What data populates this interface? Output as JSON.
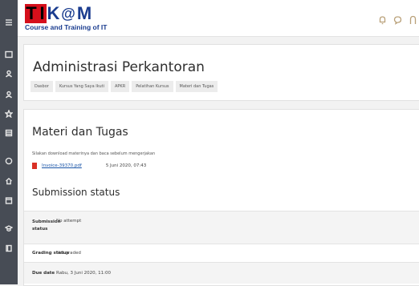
{
  "logo": {
    "letters": [
      "T",
      "I",
      "K",
      "@",
      "M"
    ],
    "tagline": "Course and Training of IT",
    "colors": {
      "red": "#d50f1b",
      "blue": "#1a3c8f"
    }
  },
  "rail": {
    "icons": [
      "menu-icon",
      "dashboard-icon",
      "users-icon",
      "users-icon",
      "star-icon",
      "grid-icon",
      "compass-icon",
      "home-icon",
      "calendar-icon",
      "graduation-icon",
      "book-icon"
    ]
  },
  "topbar": {
    "icons": [
      "bell-icon",
      "chat-icon",
      "avatar-icon"
    ]
  },
  "course": {
    "title": "Administrasi Perkantoran",
    "breadcrumbs": [
      "Dasbor",
      "Kursus Yang Saya Ikuti",
      "APKR",
      "Pelatihan Kursus",
      "Materi dan Tugas"
    ]
  },
  "assignment": {
    "title": "Materi dan Tugas",
    "intro": "Silakan download materinya dan baca sebelum mengerjakan",
    "file": {
      "name": "Invoice-39370.pdf",
      "date": "5 Juni 2020, 07:43"
    },
    "submission_title": "Submission status"
  },
  "status_table": [
    {
      "label": "Submission status",
      "value": "No attempt"
    },
    {
      "label": "Grading status",
      "value": "Not graded"
    },
    {
      "label": "Due date",
      "value": "Rabu, 3 Juni 2020, 11:00"
    }
  ]
}
